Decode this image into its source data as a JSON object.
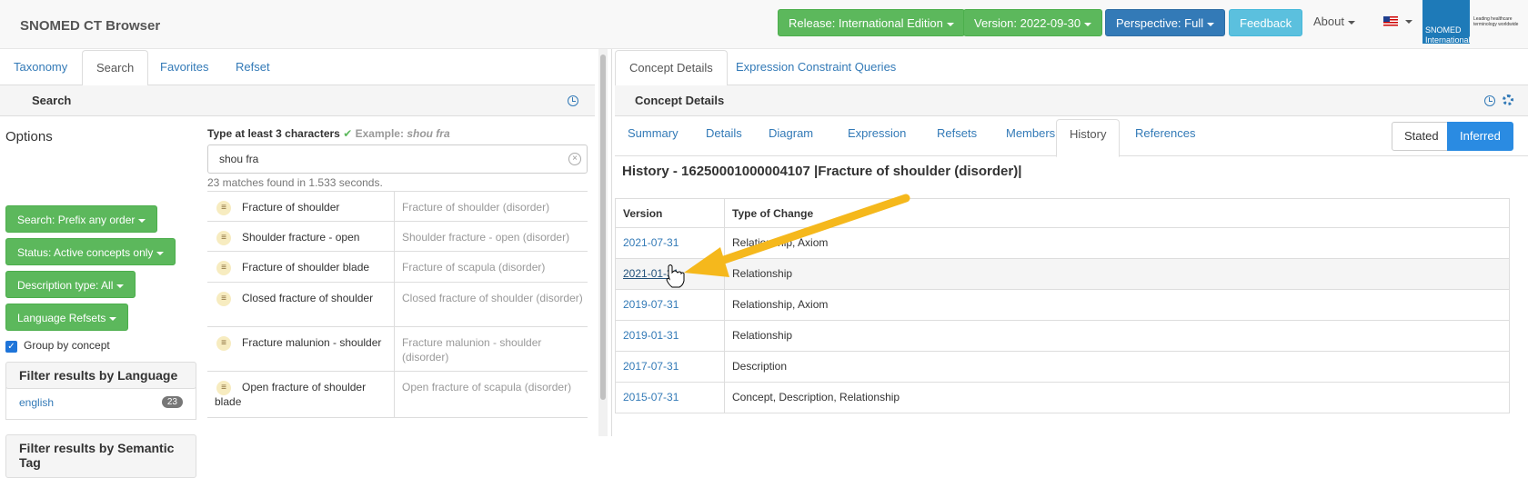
{
  "app": {
    "title": "SNOMED CT Browser"
  },
  "navbar": {
    "release": "Release: International Edition",
    "version": "Version: 2022-09-30",
    "perspective": "Perspective: Full",
    "feedback": "Feedback",
    "about": "About",
    "logo_text": "SNOMED International",
    "logo_tagline": "Leading healthcare terminology worldwide"
  },
  "left": {
    "tabs": [
      "Taxonomy",
      "Search",
      "Favorites",
      "Refset"
    ],
    "panel_title": "Search",
    "options": {
      "title": "Options",
      "search_mode": "Search: Prefix any order",
      "status": "Status: Active concepts only",
      "description_type": "Description type: All",
      "language_refsets": "Language Refsets",
      "group_by_concept": "Group by concept",
      "group_by_checked": true,
      "filter_language_title": "Filter results by Language",
      "language_link": "english",
      "language_count": "23",
      "filter_semantic_title": "Filter results by Semantic Tag"
    },
    "search": {
      "hint": "Type at least 3 characters",
      "example_label": "Example:",
      "example_value": "shou fra",
      "query": "shou fra",
      "matches": "23 matches found in 1.533 seconds."
    },
    "results": [
      {
        "term": "Fracture of shoulder",
        "fsn": "Fracture of shoulder (disorder)"
      },
      {
        "term": "Shoulder fracture - open",
        "fsn": "Shoulder fracture - open (disorder)"
      },
      {
        "term": "Fracture of shoulder blade",
        "fsn": "Fracture of scapula (disorder)"
      },
      {
        "term": "Closed fracture of shoulder",
        "fsn": "Closed fracture of shoulder (disorder)"
      },
      {
        "term": "Fracture malunion - shoulder",
        "fsn": "Fracture malunion - shoulder (disorder)"
      },
      {
        "term": "Open fracture of shoulder blade",
        "fsn": "Open fracture of scapula (disorder)"
      }
    ]
  },
  "right": {
    "tabs": [
      "Concept Details",
      "Expression Constraint Queries"
    ],
    "panel_title": "Concept Details",
    "subtabs": [
      "Summary",
      "Details",
      "Diagram",
      "Expression",
      "Refsets",
      "Members",
      "History",
      "References"
    ],
    "stated": "Stated",
    "inferred": "Inferred",
    "history_title": "History - 16250001000004107 |Fracture of shoulder (disorder)|",
    "history_headers": [
      "Version",
      "Type of Change"
    ],
    "history": [
      {
        "version": "2021-07-31",
        "change": "Relationship, Axiom"
      },
      {
        "version": "2021-01-31",
        "change": "Relationship"
      },
      {
        "version": "2019-07-31",
        "change": "Relationship, Axiom"
      },
      {
        "version": "2019-01-31",
        "change": "Relationship"
      },
      {
        "version": "2017-07-31",
        "change": "Description"
      },
      {
        "version": "2015-07-31",
        "change": "Concept, Description, Relationship"
      }
    ]
  },
  "colors": {
    "green": "#5cb85c",
    "blue": "#337ab7",
    "lightblue": "#5bc0de",
    "arrow": "#f5b81c",
    "inferred": "#2a8be2"
  }
}
